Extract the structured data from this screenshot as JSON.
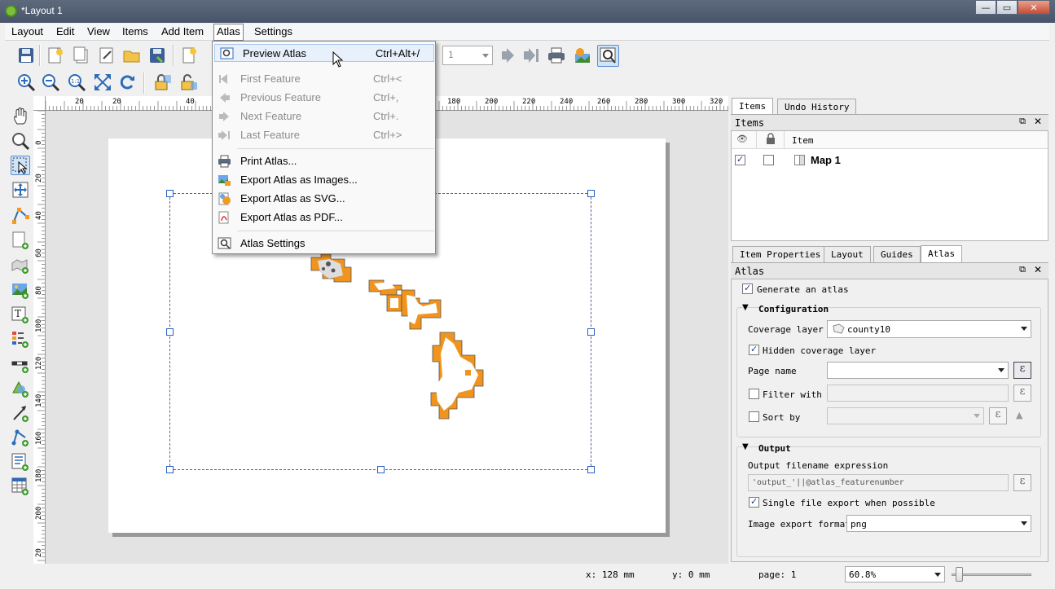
{
  "window": {
    "title": "*Layout 1",
    "min": "—",
    "max": "▭",
    "close": "✕"
  },
  "menubar": [
    {
      "label": "Layout"
    },
    {
      "label": "Edit"
    },
    {
      "label": "View"
    },
    {
      "label": "Items"
    },
    {
      "label": "Add Item"
    },
    {
      "label": "Atlas"
    },
    {
      "label": "Settings"
    }
  ],
  "atlas_menu": {
    "preview": {
      "label": "Preview Atlas",
      "shortcut": "Ctrl+Alt+/"
    },
    "first": {
      "label": "First Feature",
      "shortcut": "Ctrl+<"
    },
    "previous": {
      "label": "Previous Feature",
      "shortcut": "Ctrl+,"
    },
    "next": {
      "label": "Next Feature",
      "shortcut": "Ctrl+."
    },
    "last": {
      "label": "Last Feature",
      "shortcut": "Ctrl+>"
    },
    "print": {
      "label": "Print Atlas..."
    },
    "export_images": {
      "label": "Export Atlas as Images..."
    },
    "export_svg": {
      "label": "Export Atlas as SVG..."
    },
    "export_pdf": {
      "label": "Export Atlas as PDF..."
    },
    "settings": {
      "label": "Atlas Settings"
    }
  },
  "toolbar": {
    "page_number": "1"
  },
  "ruler": {
    "h_ticks": [
      "20",
      "20",
      "40",
      "180",
      "200",
      "220",
      "240",
      "260",
      "280",
      "300",
      "320"
    ],
    "v_ticks": [
      "0",
      "20",
      "40",
      "60",
      "80",
      "100",
      "120",
      "140",
      "160",
      "180",
      "200",
      "20"
    ]
  },
  "items_panel": {
    "tabs": [
      {
        "label": "Items"
      },
      {
        "label": "Undo History"
      }
    ],
    "title": "Items",
    "col_item": "Item",
    "rows": [
      {
        "name": "Map 1",
        "visible": true,
        "locked": false
      }
    ]
  },
  "props_tabs": [
    {
      "label": "Item Properties"
    },
    {
      "label": "Layout"
    },
    {
      "label": "Guides"
    },
    {
      "label": "Atlas"
    }
  ],
  "atlas_panel": {
    "title": "Atlas",
    "generate": "Generate an atlas",
    "config_title": "Configuration",
    "coverage_label": "Coverage layer",
    "coverage_value": "county10",
    "hidden_coverage": "Hidden coverage layer",
    "page_name": "Page name",
    "filter_with": "Filter with",
    "sort_by": "Sort by",
    "output_title": "Output",
    "output_expr_label": "Output filename expression",
    "output_expr_value": "'output_'||@atlas_featurenumber",
    "single_file": "Single file export when possible",
    "image_format_label": "Image export format",
    "image_format_value": "png",
    "epsilon": "ε"
  },
  "statusbar": {
    "x": "x: 128 mm",
    "y": "y: 0 mm",
    "page": "page: 1",
    "zoom": "60.8%"
  },
  "colors": {
    "accent": "#3a78d4",
    "map_fill": "#f0941e",
    "titlebar": "#4e5a6e"
  }
}
